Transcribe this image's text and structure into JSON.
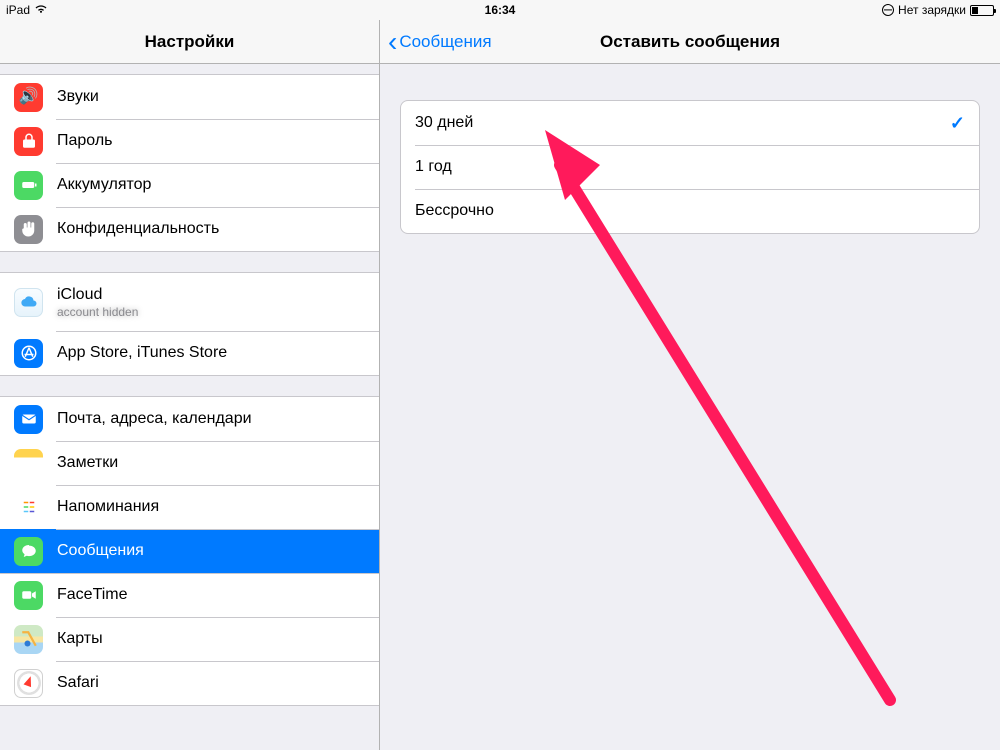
{
  "statusbar": {
    "device": "iPad",
    "time": "16:34",
    "charge_text": "Нет зарядки"
  },
  "sidebar": {
    "title": "Настройки",
    "group1": [
      {
        "label": "Звуки",
        "icon": "sounds-icon",
        "color": "ic-red"
      },
      {
        "label": "Пароль",
        "icon": "lock-icon",
        "color": "ic-red"
      },
      {
        "label": "Аккумулятор",
        "icon": "battery-icon",
        "color": "ic-green"
      },
      {
        "label": "Конфиденциальность",
        "icon": "hand-icon",
        "color": "ic-gray"
      }
    ],
    "group2": [
      {
        "label": "iCloud",
        "sub": "",
        "icon": "cloud-icon",
        "color": "ic-cloud"
      },
      {
        "label": "App Store, iTunes Store",
        "icon": "appstore-icon",
        "color": "ic-blue"
      }
    ],
    "group3": [
      {
        "label": "Почта, адреса, календари",
        "icon": "mail-icon",
        "color": "ic-blue"
      },
      {
        "label": "Заметки",
        "icon": "notes-icon",
        "color": "ic-notes"
      },
      {
        "label": "Напоминания",
        "icon": "reminders-icon",
        "color": "ic-rem"
      },
      {
        "label": "Сообщения",
        "icon": "messages-icon",
        "color": "ic-msg",
        "selected": true
      },
      {
        "label": "FaceTime",
        "icon": "facetime-icon",
        "color": "ic-ft"
      },
      {
        "label": "Карты",
        "icon": "maps-icon",
        "color": "ic-maps"
      },
      {
        "label": "Safari",
        "icon": "safari-icon",
        "color": "ic-safari"
      }
    ]
  },
  "detail": {
    "back_label": "Сообщения",
    "title": "Оставить сообщения",
    "options": [
      {
        "label": "30 дней",
        "checked": true
      },
      {
        "label": "1 год",
        "checked": false
      },
      {
        "label": "Бессрочно",
        "checked": false
      }
    ]
  },
  "colors": {
    "accent": "#007aff",
    "annotation": "#ff1a5b"
  }
}
